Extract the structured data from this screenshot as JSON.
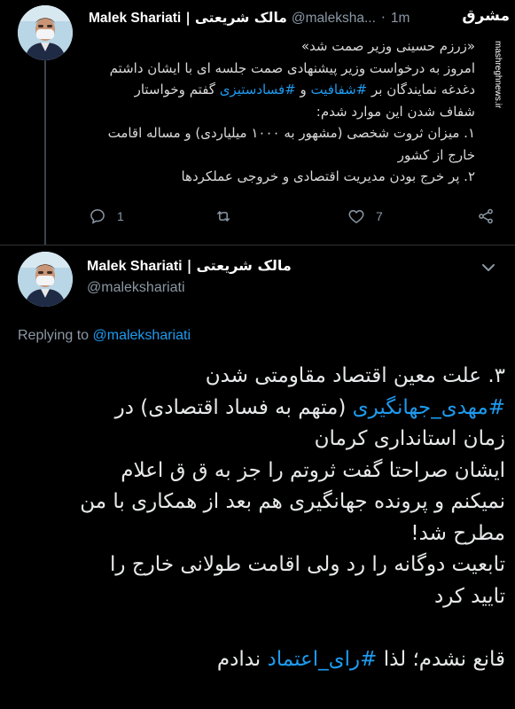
{
  "tweet1": {
    "author_en": "Malek Shariati",
    "separator": "|",
    "author_fa": "مالک شریعتی",
    "handle": "@maleksha...",
    "time_dot": "·",
    "time": "1m",
    "body_lines": [
      "«زرزم حسینی وزیر صمت شد»",
      "امروز به درخواست وزیر پیشنهادی صمت جلسه ای با ایشان داشتم",
      [
        {
          "t": "دغدغه نمایندگان بر ",
          "h": false
        },
        {
          "t": "#شفافیت",
          "h": true
        },
        {
          "t": " و ",
          "h": false
        },
        {
          "t": "#فسادستیزی",
          "h": true
        },
        {
          "t": " گفتم وخواستار",
          "h": false
        }
      ],
      "شفاف شدن این موارد شدم:",
      "۱. میزان ثروت شخصی (مشهور به ۱۰۰۰ میلیاردی) و مساله اقامت",
      "خارج از کشور",
      "۲. پر خرج بودن مدیریت اقتصادی و خروجی عملکردها"
    ],
    "actions": {
      "reply_count": "1",
      "retweet_count": "",
      "like_count": "7"
    },
    "icons": [
      "reply-icon",
      "retweet-icon",
      "like-icon",
      "share-icon"
    ]
  },
  "watermark": {
    "brand": "مشرق",
    "url": "mashreghnews.ir"
  },
  "tweet2": {
    "author_en": "Malek Shariati",
    "separator": "|",
    "author_fa": "مالک شریعتی",
    "handle": "@malekshariati",
    "replying_label": "Replying to",
    "replying_to": "@malekshariati",
    "body_lines": [
      [
        {
          "t": "۳. علت معین اقتصاد مقاومتی شدن",
          "h": false
        }
      ],
      [
        {
          "t": "#مهدی_جهانگیری",
          "h": true
        },
        {
          "t": " (متهم به فساد اقتصادی) در",
          "h": false
        }
      ],
      [
        {
          "t": "زمان استانداری کرمان",
          "h": false
        }
      ],
      [
        {
          "t": "ایشان صراحتا گفت ثروتم را جز به ق ق اعلام",
          "h": false
        }
      ],
      [
        {
          "t": "نمیکنم و پرونده جهانگیری هم بعد از همکاری با من",
          "h": false
        }
      ],
      [
        {
          "t": "مطرح شد!",
          "h": false
        }
      ],
      [
        {
          "t": "تابعیت دوگانه را رد ولی اقامت طولانی خارج را",
          "h": false
        }
      ],
      [
        {
          "t": "تایید کرد",
          "h": false
        }
      ],
      [],
      [
        {
          "t": "قانع نشدم؛ لذا ",
          "h": false
        },
        {
          "t": "#رای_اعتماد",
          "h": true
        },
        {
          "t": " ندادم",
          "h": false
        }
      ]
    ]
  },
  "colors": {
    "background": "#000000",
    "text": "#e7e9ea",
    "muted": "#8b98a5",
    "link": "#1d9bf0",
    "divider": "#2f3336"
  }
}
